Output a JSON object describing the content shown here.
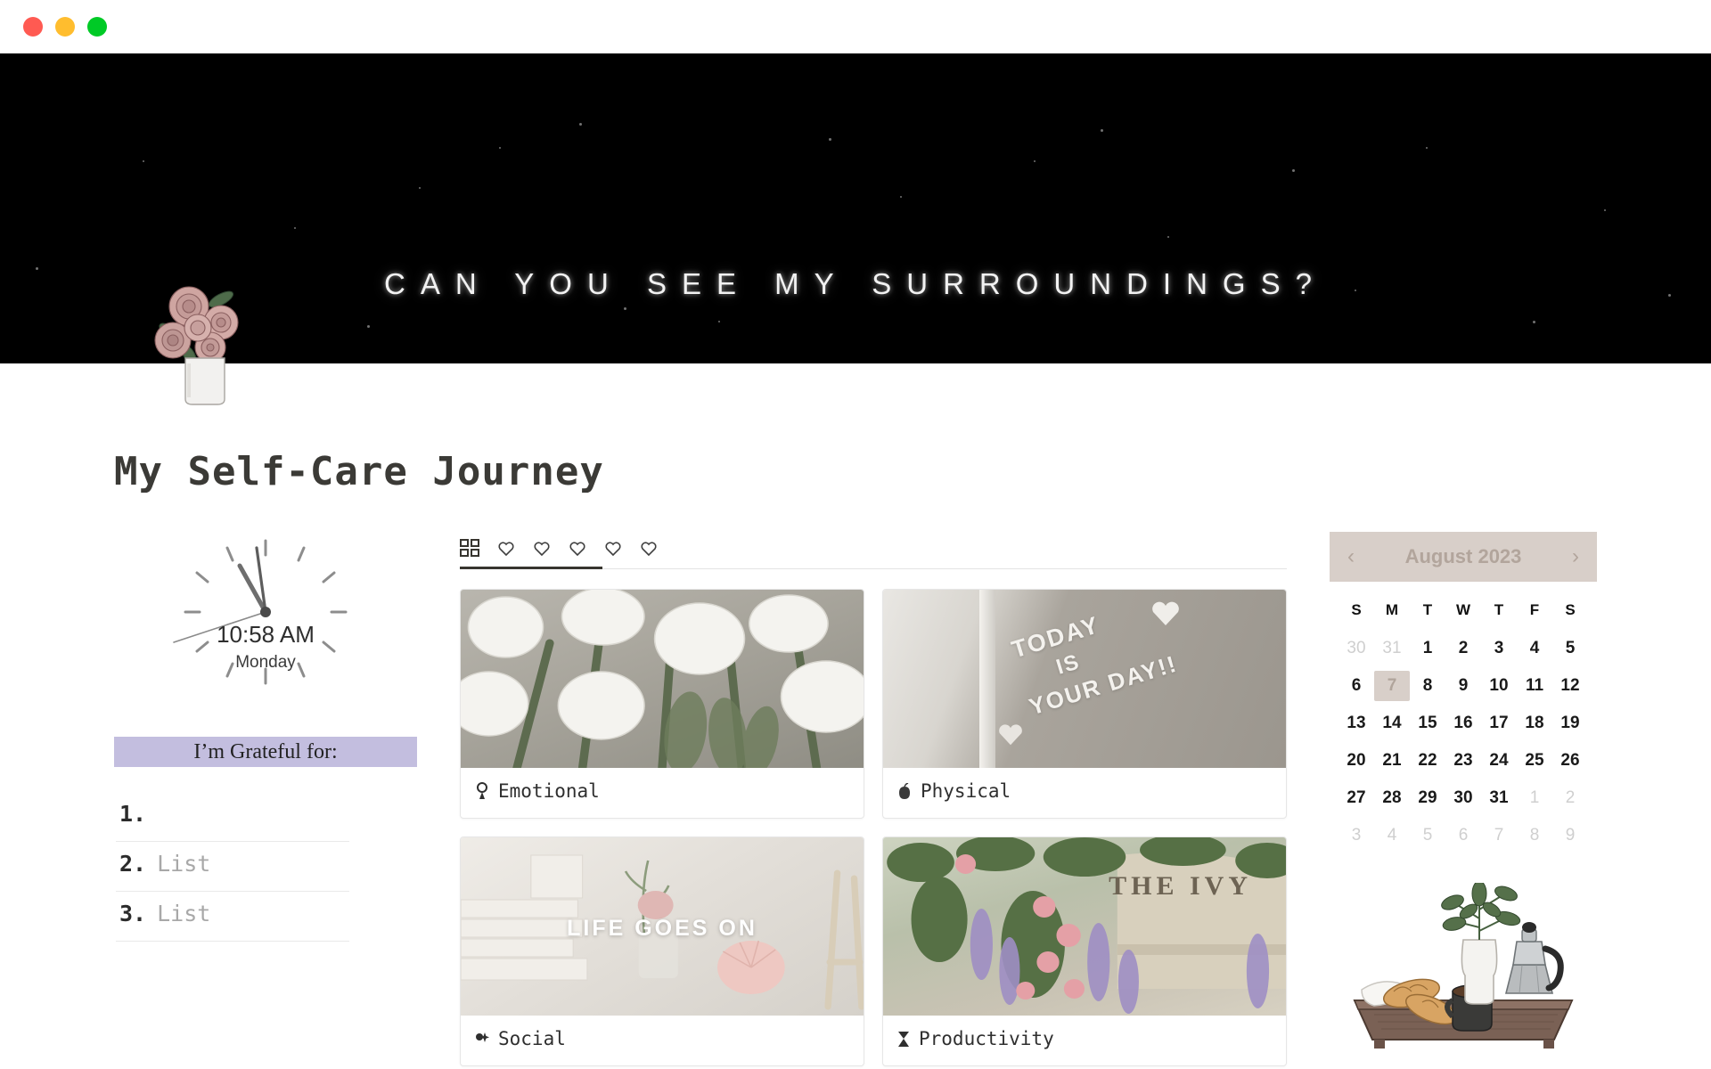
{
  "window": {
    "controls": [
      "close",
      "minimize",
      "maximize"
    ]
  },
  "banner": {
    "text": "CAN YOU SEE MY SURROUNDINGS?",
    "background_color": "#000000",
    "text_color": "#f2f2f2",
    "decoration": "roses-in-vase-illustration"
  },
  "page": {
    "title": "My Self-Care Journey"
  },
  "clock": {
    "time": "10:58 AM",
    "day": "Monday",
    "hour_angle": 329,
    "minute_angle": 348,
    "second_angle": 255
  },
  "grateful": {
    "heading": "I’m Grateful for:",
    "heading_bg": "#c3bedf",
    "items": [
      {
        "num": "1.",
        "text": ""
      },
      {
        "num": "2.",
        "text": "List"
      },
      {
        "num": "3.",
        "text": "List"
      }
    ]
  },
  "gallery": {
    "tabs": [
      {
        "name": "gallery-grid-icon",
        "label": "",
        "active": true
      },
      {
        "name": "heart-icon-1",
        "label": "",
        "active": false
      },
      {
        "name": "heart-icon-2",
        "label": "",
        "active": false
      },
      {
        "name": "heart-icon-3",
        "label": "",
        "active": false
      },
      {
        "name": "heart-icon-4",
        "label": "",
        "active": false
      },
      {
        "name": "heart-icon-5",
        "label": "",
        "active": false
      }
    ],
    "cards": [
      {
        "label": "Emotional",
        "icon": "keyhole-icon",
        "image": "white-tulips-photo"
      },
      {
        "label": "Physical",
        "icon": "apple-icon",
        "image": "mirror-message-photo"
      },
      {
        "label": "Social",
        "icon": "sparkle-icon",
        "image": "aesthetic-flatlay-photo"
      },
      {
        "label": "Productivity",
        "icon": "hourglass-icon",
        "image": "the-ivy-facade-photo"
      }
    ],
    "image_texts": {
      "mirror_line1": "TODAY",
      "mirror_line2": "IS",
      "mirror_line3": "YOUR DAY!!",
      "social_overlay": "LIFE GOES ON",
      "ivy_sign": "THE IVY"
    }
  },
  "calendar": {
    "title": "August 2023",
    "prev_label": "‹",
    "next_label": "›",
    "header_bg": "#d8cfc9",
    "weekdays": [
      "S",
      "M",
      "T",
      "W",
      "T",
      "F",
      "S"
    ],
    "weeks": [
      [
        {
          "d": "30",
          "m": true
        },
        {
          "d": "31",
          "m": true
        },
        {
          "d": "1"
        },
        {
          "d": "2"
        },
        {
          "d": "3"
        },
        {
          "d": "4"
        },
        {
          "d": "5"
        }
      ],
      [
        {
          "d": "6"
        },
        {
          "d": "7",
          "today": true
        },
        {
          "d": "8"
        },
        {
          "d": "9"
        },
        {
          "d": "10"
        },
        {
          "d": "11"
        },
        {
          "d": "12"
        }
      ],
      [
        {
          "d": "13"
        },
        {
          "d": "14"
        },
        {
          "d": "15"
        },
        {
          "d": "16"
        },
        {
          "d": "17"
        },
        {
          "d": "18"
        },
        {
          "d": "19"
        }
      ],
      [
        {
          "d": "20"
        },
        {
          "d": "21"
        },
        {
          "d": "22"
        },
        {
          "d": "23"
        },
        {
          "d": "24"
        },
        {
          "d": "25"
        },
        {
          "d": "26"
        }
      ],
      [
        {
          "d": "27"
        },
        {
          "d": "28"
        },
        {
          "d": "29"
        },
        {
          "d": "30"
        },
        {
          "d": "31"
        },
        {
          "d": "1",
          "m": true
        },
        {
          "d": "2",
          "m": true
        }
      ],
      [
        {
          "d": "3",
          "m": true
        },
        {
          "d": "4",
          "m": true
        },
        {
          "d": "5",
          "m": true
        },
        {
          "d": "6",
          "m": true
        },
        {
          "d": "7",
          "m": true
        },
        {
          "d": "8",
          "m": true
        },
        {
          "d": "9",
          "m": true
        }
      ]
    ]
  },
  "sidebar_illustration": {
    "name": "breakfast-tray-illustration",
    "items": [
      "croissants",
      "napkin",
      "coffee-mug",
      "vase-with-plant",
      "moka-pot"
    ]
  }
}
